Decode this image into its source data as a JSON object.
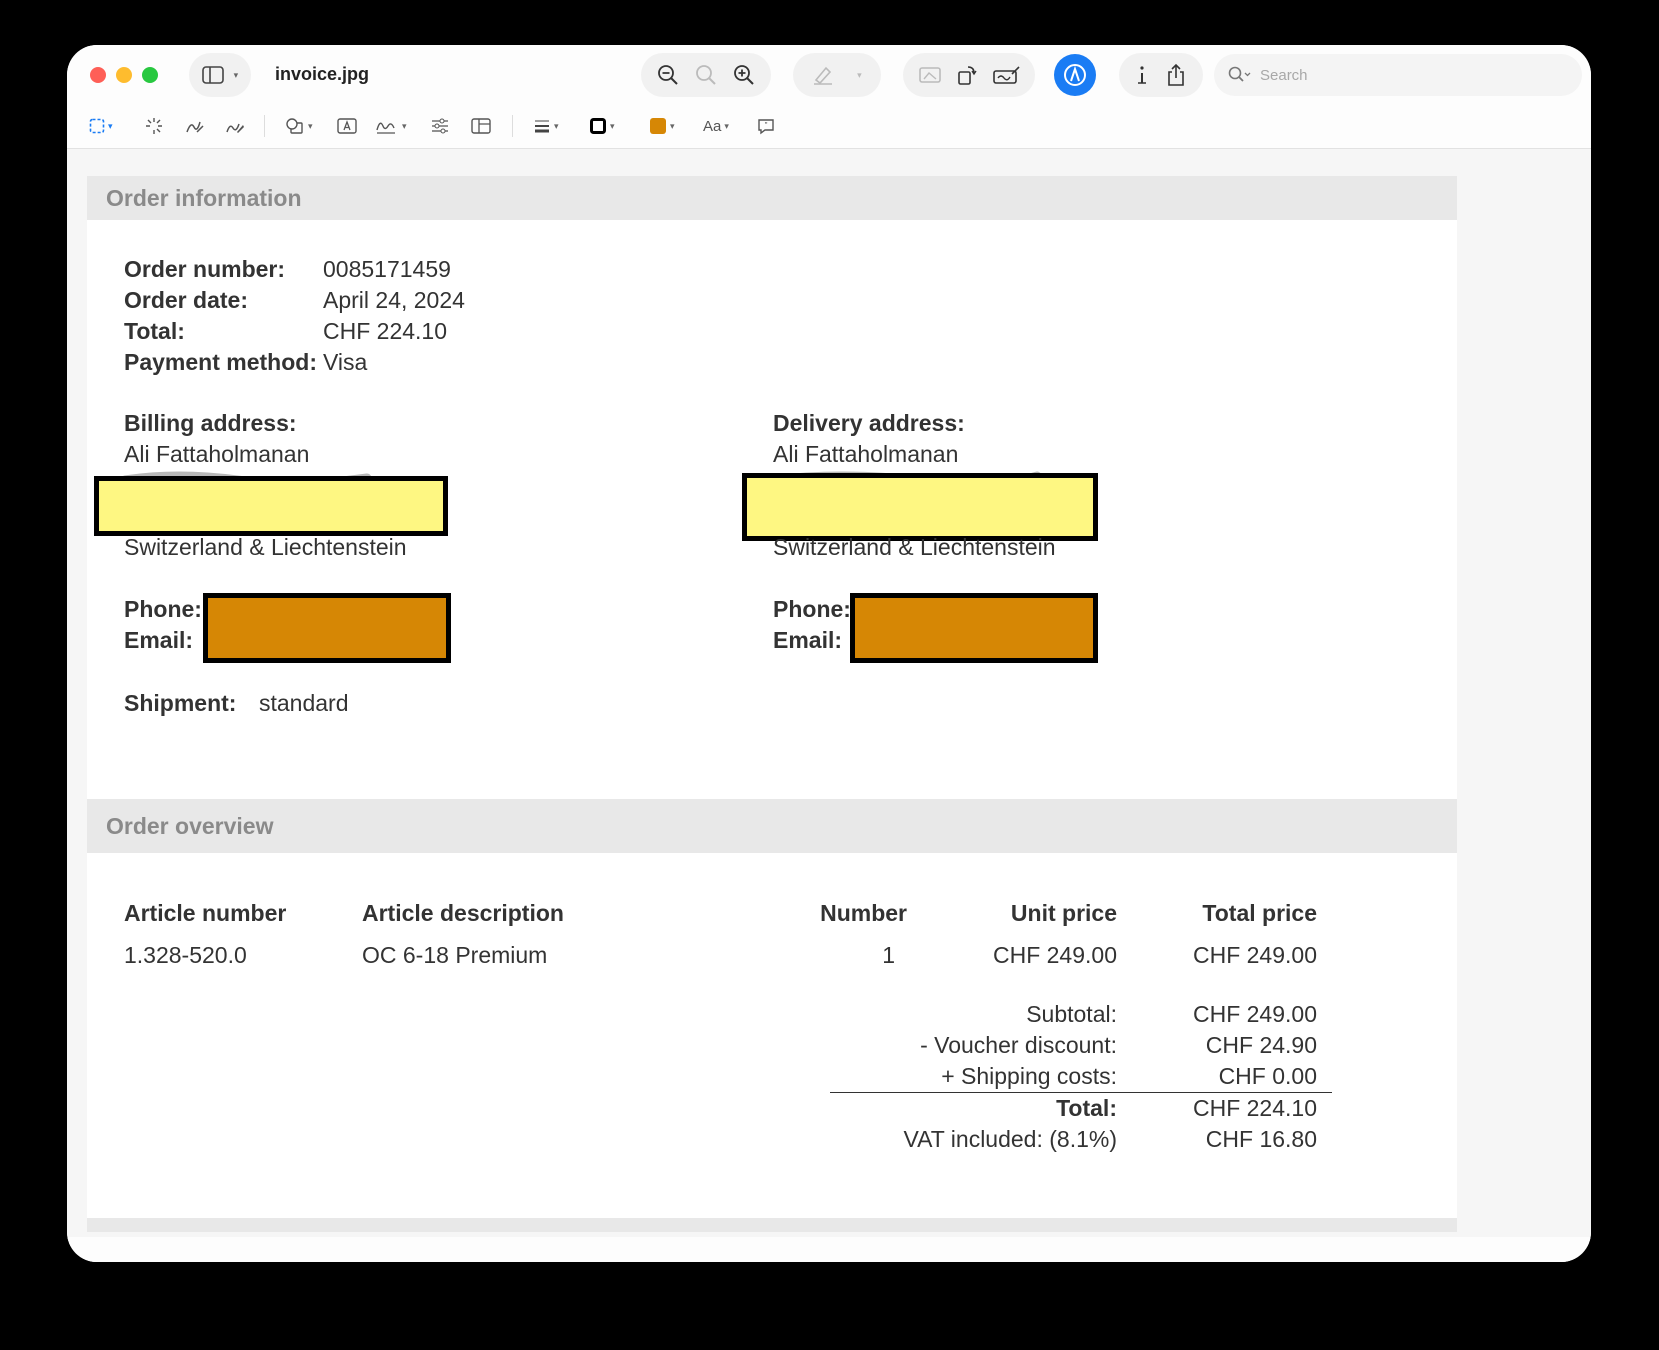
{
  "titlebar": {
    "document_title": "invoice.jpg",
    "search_placeholder": "Search",
    "icons": [
      "sidebar-icon",
      "zoom-out-icon",
      "actual-size-icon",
      "zoom-in-icon",
      "highlight-pen-icon",
      "crop-icon",
      "rotate-icon",
      "sign-icon",
      "markup-icon",
      "info-icon",
      "share-icon",
      "search-icon"
    ]
  },
  "markup_toolbar": {
    "text_style_label": "Aa",
    "fill_color": "#d68705",
    "border_color": "#000000",
    "accent": "#1a7cf4"
  },
  "invoice": {
    "order_info": {
      "heading": "Order information",
      "order_number_label": "Order number:",
      "order_number": "0085171459",
      "order_date_label": "Order date:",
      "order_date": "April 24, 2024",
      "total_label": "Total:",
      "total": "CHF 224.10",
      "payment_method_label": "Payment method:",
      "payment_method": "Visa"
    },
    "billing": {
      "label": "Billing address:",
      "name": "Ali Fattaholmanan",
      "country": "Switzerland & Liechtenstein",
      "phone_label": "Phone:",
      "email_label": "Email:"
    },
    "delivery": {
      "label": "Delivery address:",
      "name": "Ali Fattaholmanan",
      "country": "Switzerland & Liechtenstein",
      "phone_label": "Phone:",
      "email_label": "Email:"
    },
    "shipment_label": "Shipment:",
    "shipment": "standard",
    "overview": {
      "heading": "Order overview",
      "columns": {
        "article_number": "Article number",
        "article_description": "Article description",
        "number": "Number",
        "unit_price": "Unit price",
        "total_price": "Total price"
      },
      "row": {
        "article_number": "1.328-520.0",
        "article_description": "OC 6-18 Premium",
        "number": "1",
        "unit_price": "CHF 249.00",
        "total_price": "CHF 249.00"
      },
      "summary": {
        "subtotal_label": "Subtotal:",
        "subtotal": "CHF 249.00",
        "voucher_label": "- Voucher discount:",
        "voucher": "CHF 24.90",
        "shipping_label": "+ Shipping costs:",
        "shipping": "CHF 0.00",
        "total_label": "Total:",
        "total": "CHF 224.10",
        "vat_label": "VAT included: (8.1%)",
        "vat": "CHF 16.80"
      }
    }
  },
  "redaction_colors": {
    "address_highlight": "#fef782",
    "contact_box": "#d68705"
  }
}
